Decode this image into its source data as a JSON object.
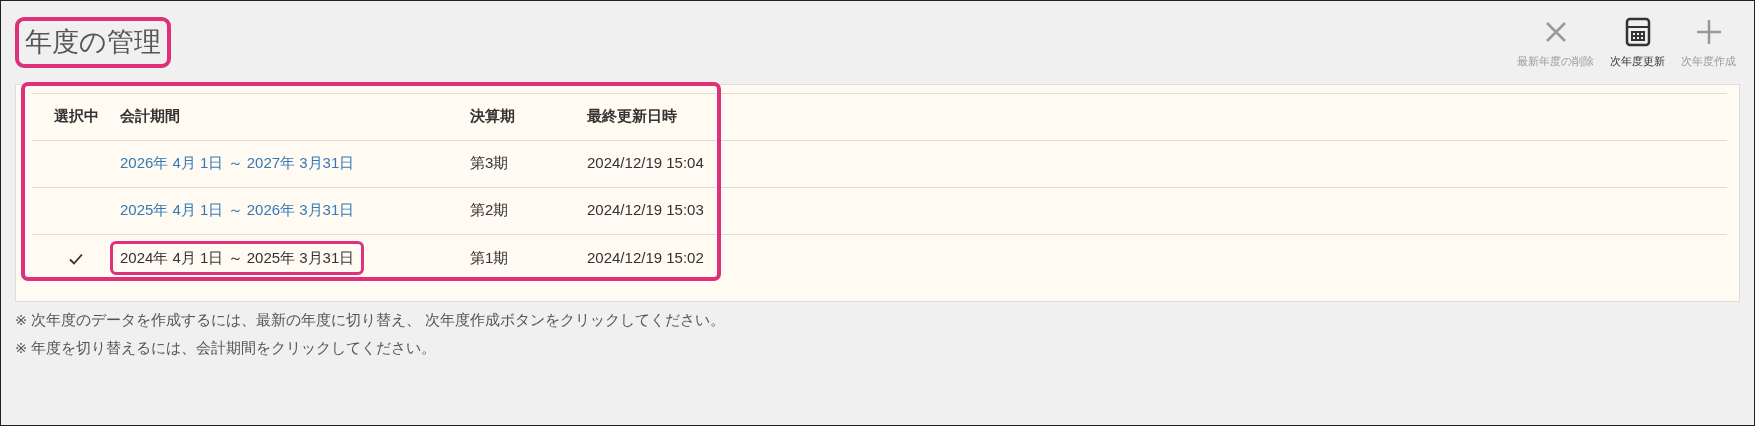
{
  "title": {
    "text": "年度の管理",
    "highlighted": true
  },
  "toolbar": [
    {
      "kind": "delete",
      "label": "最新年度の削除",
      "disabled": true
    },
    {
      "kind": "update",
      "label": "次年度更新",
      "disabled": false
    },
    {
      "kind": "create",
      "label": "次年度作成",
      "disabled": true
    }
  ],
  "table": {
    "highlighted": true,
    "columns": [
      "選択中",
      "会計期間",
      "決算期",
      "最終更新日時"
    ],
    "rows": [
      {
        "selected": false,
        "highlighted": false,
        "period": "2026年 4月 1日 ～ 2027年 3月31日",
        "term": "第3期",
        "updated": "2024/12/19 15:04"
      },
      {
        "selected": false,
        "highlighted": false,
        "period": "2025年 4月 1日 ～ 2026年 3月31日",
        "term": "第2期",
        "updated": "2024/12/19 15:03"
      },
      {
        "selected": true,
        "highlighted": true,
        "period": "2024年 4月 1日 ～ 2025年 3月31日",
        "term": "第1期",
        "updated": "2024/12/19 15:02"
      }
    ]
  },
  "notes": [
    "※ 次年度のデータを作成するには、最新の年度に切り替え、 次年度作成ボタンをクリックしてください。",
    "※ 年度を切り替えるには、会計期間をクリックしてください。"
  ]
}
